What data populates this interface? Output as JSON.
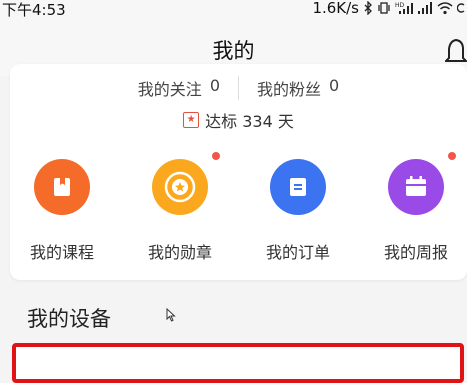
{
  "status_bar": {
    "time": "下午4:53",
    "network_speed": "1.6K/s",
    "icons": [
      "bluetooth-icon",
      "vibrate-icon",
      "hd-signal-icon",
      "signal-icon",
      "wifi-icon",
      "battery-icon"
    ]
  },
  "header": {
    "title": "我的",
    "bell_icon": "bell-icon"
  },
  "profile": {
    "following": {
      "label": "我的关注",
      "count": "0"
    },
    "followers": {
      "label": "我的粉丝",
      "count": "0"
    },
    "streak": {
      "text": "达标 334 天",
      "icon": "flag-icon"
    }
  },
  "menu": [
    {
      "label": "我的课程",
      "icon": "book-icon",
      "color": "#f46b2a",
      "badge": false
    },
    {
      "label": "我的勋章",
      "icon": "medal-icon",
      "color": "#fba81e",
      "badge": true
    },
    {
      "label": "我的订单",
      "icon": "order-icon",
      "color": "#3b73f0",
      "badge": false
    },
    {
      "label": "我的周报",
      "icon": "calendar-icon",
      "color": "#9a4ae6",
      "badge": true
    }
  ],
  "section": {
    "title": "我的设备"
  },
  "colors": {
    "badge": "#f0574a",
    "highlight_border": "#e01414",
    "streak_icon": "#e5503f"
  }
}
